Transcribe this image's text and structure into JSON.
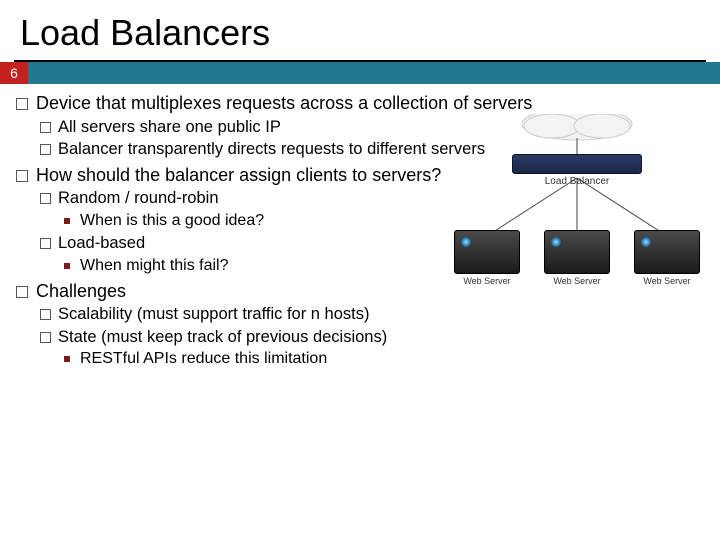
{
  "title": "Load Balancers",
  "page_number": "6",
  "diagram": {
    "lb_label": "Load Balancer",
    "server_label": "Web Server"
  },
  "bullets": {
    "b1": "Device that multiplexes requests across a collection of servers",
    "b1_1": "All servers share one public IP",
    "b1_2": "Balancer transparently directs requests to different servers",
    "b2": "How should the balancer assign clients to servers?",
    "b2_1": "Random / round-robin",
    "b2_1_1": "When is this a good idea?",
    "b2_2": "Load-based",
    "b2_2_1": "When might this fail?",
    "b3": "Challenges",
    "b3_1": "Scalability (must support traffic for n hosts)",
    "b3_2": "State (must keep track of previous decisions)",
    "b3_2_1": "RESTful APIs reduce this limitation"
  }
}
